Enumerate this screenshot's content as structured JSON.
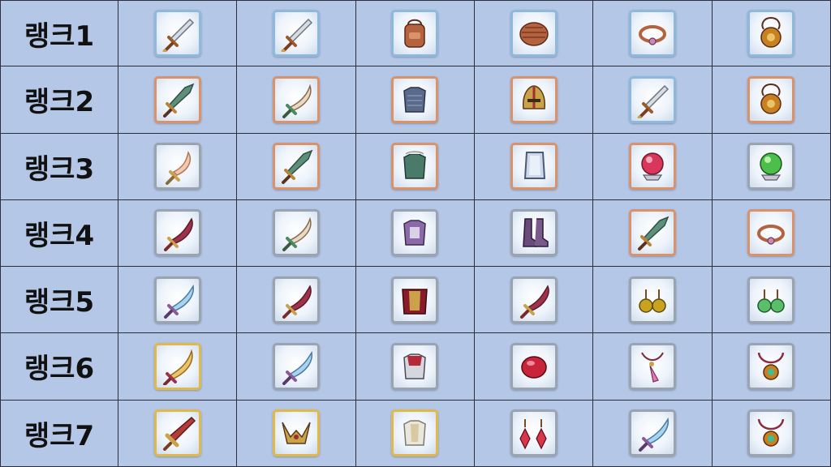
{
  "colors": {
    "background": "#b4c7e7",
    "grid_line": "#2a2f3a",
    "frame_blue": "#8fb8dd",
    "frame_copper": "#d9926a",
    "frame_silver": "#9aa4b0",
    "frame_gold": "#e0b94a"
  },
  "ranks": [
    {
      "label": "랭크1",
      "items": [
        {
          "icon": "sword-icon",
          "frame": "blue"
        },
        {
          "icon": "sword-icon",
          "frame": "blue"
        },
        {
          "icon": "backpack-armor-icon",
          "frame": "blue"
        },
        {
          "icon": "leather-cap-icon",
          "frame": "blue"
        },
        {
          "icon": "bracelet-icon",
          "frame": "blue"
        },
        {
          "icon": "amulet-icon",
          "frame": "blue"
        }
      ]
    },
    {
      "label": "랭크2",
      "items": [
        {
          "icon": "spear-sword-icon",
          "frame": "copper"
        },
        {
          "icon": "scimitar-icon",
          "frame": "copper"
        },
        {
          "icon": "chainmail-icon",
          "frame": "copper"
        },
        {
          "icon": "helmet-icon",
          "frame": "copper"
        },
        {
          "icon": "sword-icon",
          "frame": "blue"
        },
        {
          "icon": "amulet-icon",
          "frame": "copper"
        }
      ]
    },
    {
      "label": "랭크3",
      "items": [
        {
          "icon": "curved-dagger-icon",
          "frame": "silver"
        },
        {
          "icon": "spear-sword-icon",
          "frame": "copper"
        },
        {
          "icon": "plate-armor-icon",
          "frame": "copper"
        },
        {
          "icon": "shield-icon",
          "frame": "copper"
        },
        {
          "icon": "red-orb-icon",
          "frame": "copper"
        },
        {
          "icon": "green-orb-icon",
          "frame": "silver"
        }
      ]
    },
    {
      "label": "랭크4",
      "items": [
        {
          "icon": "crimson-blade-icon",
          "frame": "silver"
        },
        {
          "icon": "scimitar-icon",
          "frame": "silver"
        },
        {
          "icon": "purple-armor-icon",
          "frame": "silver"
        },
        {
          "icon": "boots-icon",
          "frame": "silver"
        },
        {
          "icon": "spear-sword-icon",
          "frame": "copper"
        },
        {
          "icon": "bracelet-icon",
          "frame": "copper"
        }
      ]
    },
    {
      "label": "랭크5",
      "items": [
        {
          "icon": "ice-blade-icon",
          "frame": "silver"
        },
        {
          "icon": "crimson-blade-icon",
          "frame": "silver"
        },
        {
          "icon": "caped-armor-icon",
          "frame": "silver"
        },
        {
          "icon": "crimson-blade-icon",
          "frame": "silver"
        },
        {
          "icon": "gold-earrings-icon",
          "frame": "silver"
        },
        {
          "icon": "green-earrings-icon",
          "frame": "silver"
        }
      ]
    },
    {
      "label": "랭크6",
      "items": [
        {
          "icon": "golden-blade-icon",
          "frame": "gold"
        },
        {
          "icon": "ice-blade-icon",
          "frame": "silver"
        },
        {
          "icon": "red-plate-armor-icon",
          "frame": "silver"
        },
        {
          "icon": "red-gem-icon",
          "frame": "silver"
        },
        {
          "icon": "feather-necklace-icon",
          "frame": "silver"
        },
        {
          "icon": "jade-necklace-icon",
          "frame": "silver"
        }
      ]
    },
    {
      "label": "랭크7",
      "items": [
        {
          "icon": "great-sword-icon",
          "frame": "gold"
        },
        {
          "icon": "winged-tiara-icon",
          "frame": "gold"
        },
        {
          "icon": "white-armor-icon",
          "frame": "gold"
        },
        {
          "icon": "ruby-earrings-icon",
          "frame": "silver"
        },
        {
          "icon": "ice-blade-icon",
          "frame": "silver"
        },
        {
          "icon": "jade-necklace-icon",
          "frame": "silver"
        }
      ]
    }
  ]
}
